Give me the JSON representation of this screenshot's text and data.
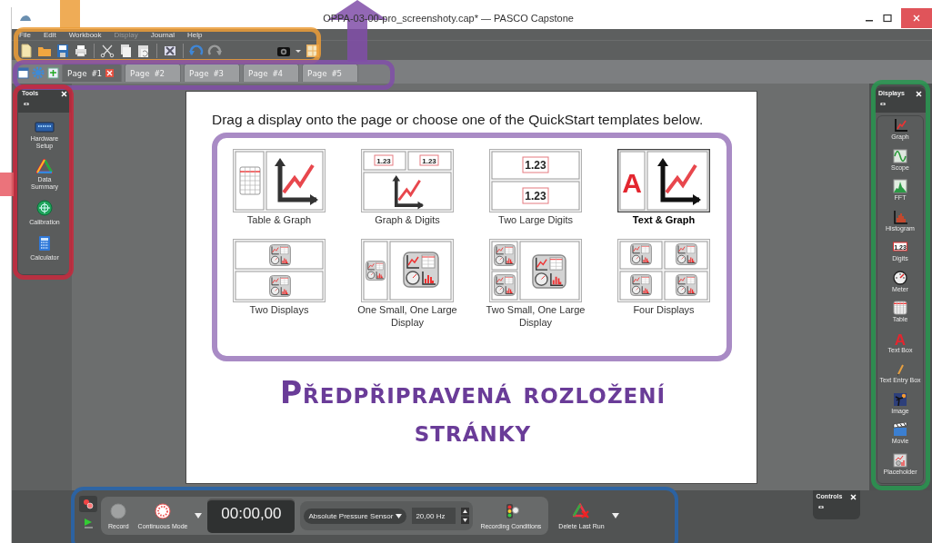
{
  "window": {
    "title": "OPPA-03-00-pro_screenshoty.cap* — PASCO Capstone"
  },
  "menu": [
    {
      "label": "File",
      "disabled": false
    },
    {
      "label": "Edit",
      "disabled": false
    },
    {
      "label": "Workbook",
      "disabled": false
    },
    {
      "label": "Display",
      "disabled": true
    },
    {
      "label": "Journal",
      "disabled": false
    },
    {
      "label": "Help",
      "disabled": false
    }
  ],
  "page_tabs": [
    {
      "label": "Page #1",
      "selected": true
    },
    {
      "label": "Page #2",
      "selected": false
    },
    {
      "label": "Page #3",
      "selected": false
    },
    {
      "label": "Page #4",
      "selected": false
    },
    {
      "label": "Page #5",
      "selected": false
    }
  ],
  "tools_panel": {
    "title": "Tools",
    "items": [
      {
        "label": "Hardware Setup",
        "kind": "hardware"
      },
      {
        "label": "Data Summary",
        "kind": "summary"
      },
      {
        "label": "Calibration",
        "kind": "calibration"
      },
      {
        "label": "Calculator",
        "kind": "calculator"
      }
    ]
  },
  "page": {
    "instruction": "Drag a display onto the page or choose one of the QuickStart templates below.",
    "templates": [
      {
        "label": "Table & Graph",
        "kind": "table-graph",
        "selected": false
      },
      {
        "label": "Graph & Digits",
        "kind": "graph-digits",
        "selected": false,
        "samples": [
          "1.23",
          "1.23"
        ]
      },
      {
        "label": "Two Large Digits",
        "kind": "two-digits",
        "selected": false,
        "samples": [
          "1.23",
          "1.23"
        ]
      },
      {
        "label": "Text & Graph",
        "kind": "text-graph",
        "selected": true,
        "samples": [
          "A"
        ]
      },
      {
        "label": "Two Displays",
        "kind": "two-displays",
        "selected": false
      },
      {
        "label": "One Small, One Large Display",
        "kind": "one-small-one-large",
        "selected": false
      },
      {
        "label": "Two Small, One Large Display",
        "kind": "two-small-one-large",
        "selected": false
      },
      {
        "label": "Four Displays",
        "kind": "four-displays",
        "selected": false
      }
    ]
  },
  "caption": "Předpřipravená rozložení stránky",
  "displays_panel": {
    "title": "Displays",
    "items": [
      {
        "label": "Graph",
        "kind": "graph"
      },
      {
        "label": "Scope",
        "kind": "scope"
      },
      {
        "label": "FFT",
        "kind": "fft"
      },
      {
        "label": "Histogram",
        "kind": "histogram"
      },
      {
        "label": "Digits",
        "kind": "digits",
        "sample": "1.23"
      },
      {
        "label": "Meter",
        "kind": "meter"
      },
      {
        "label": "Table",
        "kind": "table"
      },
      {
        "label": "Text Box",
        "kind": "textbox",
        "sample": "A"
      },
      {
        "label": "Text Entry Box",
        "kind": "textentry"
      },
      {
        "label": "Image",
        "kind": "image"
      },
      {
        "label": "Movie",
        "kind": "movie"
      },
      {
        "label": "Placeholder",
        "kind": "placeholder"
      }
    ]
  },
  "controls": {
    "record": "Record",
    "mode": "Continuous Mode",
    "time": "00:00,00",
    "sensor": "Absolute Pressure Sensor",
    "rate": "20,00 Hz",
    "conditions": "Recording Conditions",
    "delete": "Delete Last Run"
  },
  "controls_panel": {
    "title": "Controls"
  }
}
